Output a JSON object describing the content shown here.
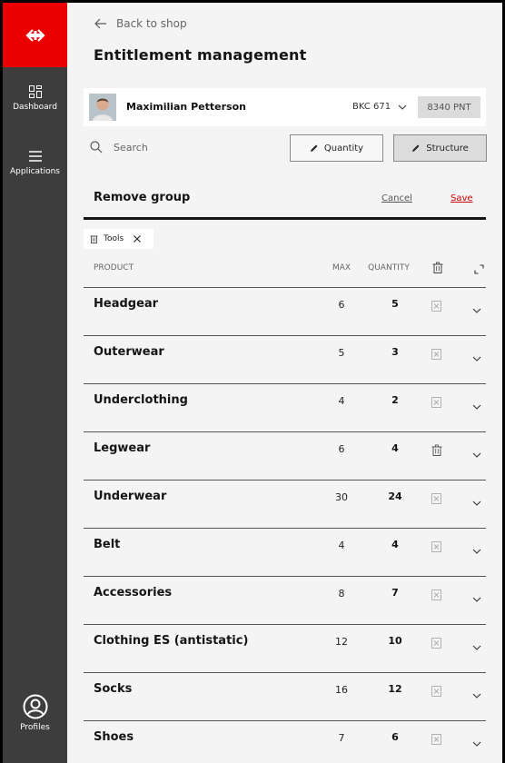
{
  "sidebar": {
    "logo": "sbb-logo",
    "items": [
      {
        "label": "Dashboard",
        "icon": "dashboard-icon"
      },
      {
        "label": "Applications",
        "icon": "menu-icon"
      }
    ],
    "profile": {
      "label": "Profiles",
      "icon": "user-icon"
    }
  },
  "header": {
    "back_label": "Back to shop",
    "title": "Entitlement management"
  },
  "user": {
    "name": "Maximilian Petterson",
    "code": "BKC 671",
    "points": "8340 PNT"
  },
  "toolbar": {
    "search_placeholder": "Search",
    "quantity_label": "Quantity",
    "structure_label": "Structure"
  },
  "group": {
    "title": "Remove group",
    "cancel_label": "Cancel",
    "save_label": "Save",
    "chip_label": "Tools"
  },
  "table": {
    "col_product": "PRODUCT",
    "col_max": "MAX",
    "col_quantity": "QUANTITY",
    "rows": [
      {
        "name": "Headgear",
        "max": "6",
        "quantity": "5",
        "delete_enabled": false
      },
      {
        "name": "Outerwear",
        "max": "5",
        "quantity": "3",
        "delete_enabled": false
      },
      {
        "name": "Underclothing",
        "max": "4",
        "quantity": "2",
        "delete_enabled": false
      },
      {
        "name": "Legwear",
        "max": "6",
        "quantity": "4",
        "delete_enabled": true
      },
      {
        "name": "Underwear",
        "max": "30",
        "quantity": "24",
        "delete_enabled": false
      },
      {
        "name": "Belt",
        "max": "4",
        "quantity": "4",
        "delete_enabled": false
      },
      {
        "name": "Accessories",
        "max": "8",
        "quantity": "7",
        "delete_enabled": false
      },
      {
        "name": "Clothing ES (antistatic)",
        "max": "12",
        "quantity": "10",
        "delete_enabled": false
      },
      {
        "name": "Socks",
        "max": "16",
        "quantity": "12",
        "delete_enabled": false
      },
      {
        "name": "Shoes",
        "max": "7",
        "quantity": "6",
        "delete_enabled": false
      }
    ]
  },
  "colors": {
    "brand": "#eb0000",
    "sidebar": "#3d3d3d",
    "background": "#f4f4f4"
  }
}
